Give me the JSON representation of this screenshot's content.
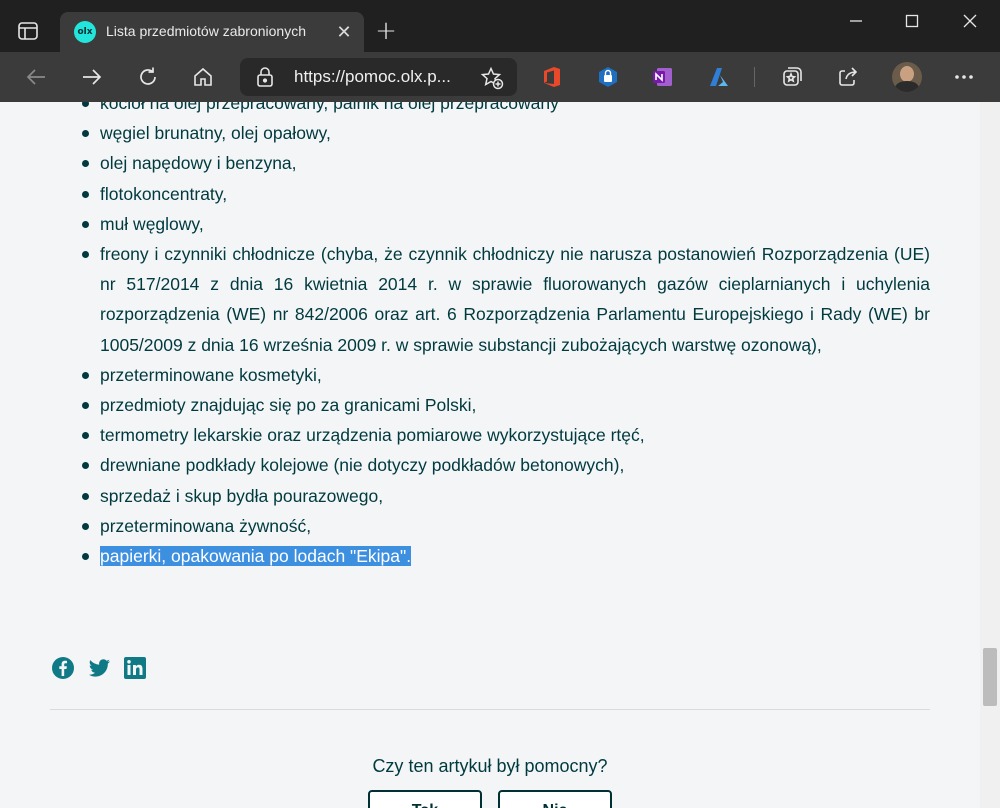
{
  "browser": {
    "tab_title": "Lista przedmiotów zabronionych",
    "favicon_text": "olx",
    "url": "https://pomoc.olx.p...",
    "icons": [
      "tab-actions-icon",
      "close-icon",
      "new-tab-icon",
      "minimize-icon",
      "maximize-icon",
      "window-close-icon",
      "back-icon",
      "forward-icon",
      "refresh-icon",
      "home-icon",
      "lock-icon",
      "add-favorite-icon",
      "office-icon",
      "extension-icon",
      "onenote-icon",
      "azure-icon",
      "collections-icon",
      "share-icon",
      "profile-avatar",
      "more-icon"
    ]
  },
  "article": {
    "items": [
      "kocioł na olej przepracowany, palnik na olej przepracowany",
      "węgiel brunatny, olej opałowy,",
      "olej napędowy i benzyna,",
      "flotokoncentraty,",
      "muł węglowy,",
      "freony i czynniki chłodnicze (chyba, że czynnik chłodniczy nie narusza postanowień Rozporządzenia (UE) nr 517/2014 z dnia 16 kwietnia 2014 r. w sprawie fluorowanych gazów cieplarnianych i uchylenia rozporządzenia (WE) nr 842/2006 oraz art. 6 Rozporządzenia Parlamentu Europejskiego i Rady (WE) br 1005/2009 z dnia 16 września 2009 r. w sprawie substancji zubożających warstwę ozonową),",
      "przeterminowane kosmetyki,",
      "przedmioty znajdując się po za granicami Polski,",
      "termometry lekarskie oraz urządzenia pomiarowe wykorzystujące rtęć,",
      "drewniane podkłady kolejowe (nie dotyczy podkładów betonowych),",
      "sprzedaż i skup bydła pourazowego,",
      "przeterminowana żywność,"
    ],
    "highlighted_item": "papierki, opakowania po lodach \"Ekipa\".",
    "highlight_color": "#3d8fe0",
    "text_color": "#003a3f"
  },
  "share": {
    "icons": [
      "facebook-icon",
      "twitter-icon",
      "linkedin-icon"
    ],
    "color": "#0f7a86"
  },
  "feedback": {
    "question": "Czy ten artykuł był pomocny?",
    "yes_label": "Tak",
    "no_label": "Nie"
  }
}
